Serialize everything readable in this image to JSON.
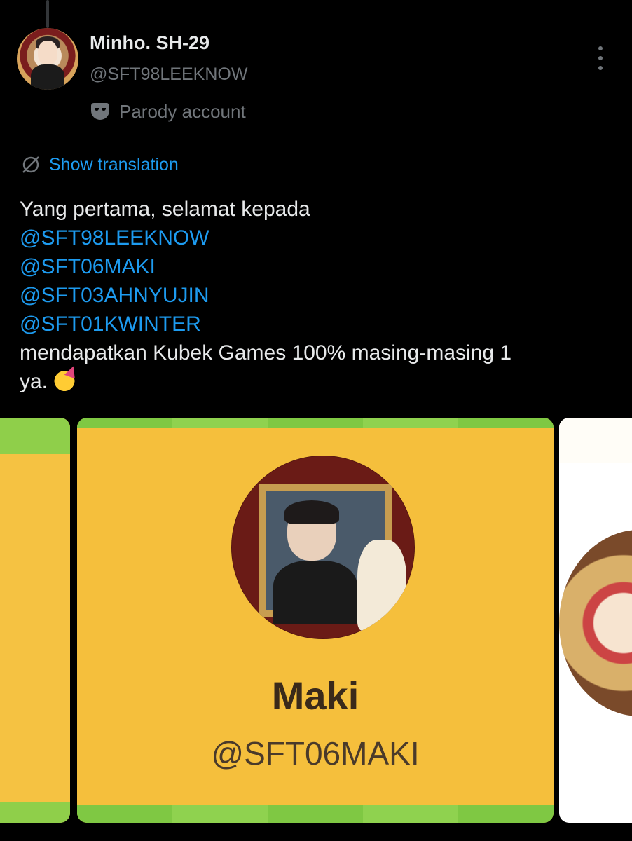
{
  "post": {
    "author": {
      "display_name": "Minho. SH-29",
      "handle": "@SFT98LEEKNOW",
      "badge_label": "Parody account"
    },
    "translate_label": "Show translation",
    "text": {
      "line1": "Yang pertama, selamat kepada",
      "mentions": [
        "@SFT98LEEKNOW",
        "@SFT06MAKI",
        "@SFT03AHNYUJIN",
        "@SFT01KWINTER"
      ],
      "line6": "mendapatkan Kubek Games 100% masing-masing 1",
      "line7": "ya."
    }
  },
  "media": {
    "card": {
      "name": "Maki",
      "handle": "@SFT06MAKI"
    }
  },
  "colors": {
    "background": "#000000",
    "link": "#1d9bf0",
    "muted": "#71767b",
    "card_yellow": "#f5bf3c",
    "card_green": "#7fc843"
  },
  "icons": {
    "more": "more-vertical-icon",
    "parody": "mask-icon",
    "translate": "translate-icon",
    "emoji": "partying-face-emoji"
  }
}
